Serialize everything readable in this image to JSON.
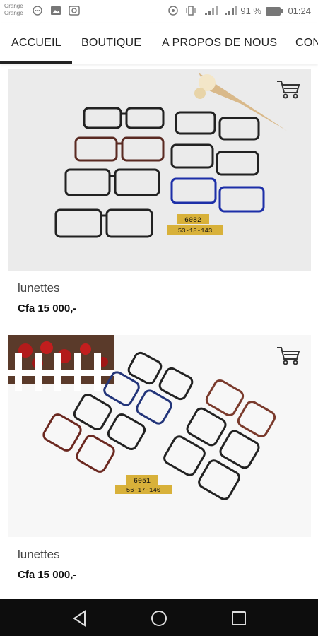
{
  "status": {
    "carrier1": "Orange",
    "carrier2": "Orange",
    "battery": "91 %",
    "time": "01:24"
  },
  "nav": {
    "items": [
      "ACCUEIL",
      "BOUTIQUE",
      "A PROPOS DE NOUS",
      "CON"
    ]
  },
  "products": [
    {
      "name": "lunettes",
      "price": "Cfa 15 000,-",
      "tag_model": "6082",
      "tag_size": "53-18-143"
    },
    {
      "name": "lunettes",
      "price": "Cfa 15 000,-",
      "tag_model": "6051",
      "tag_size": "56-17-140"
    }
  ],
  "icons": {
    "cart": "shopping-cart-icon",
    "back": "back-triangle-icon",
    "home": "home-circle-icon",
    "recent": "recent-square-icon"
  }
}
